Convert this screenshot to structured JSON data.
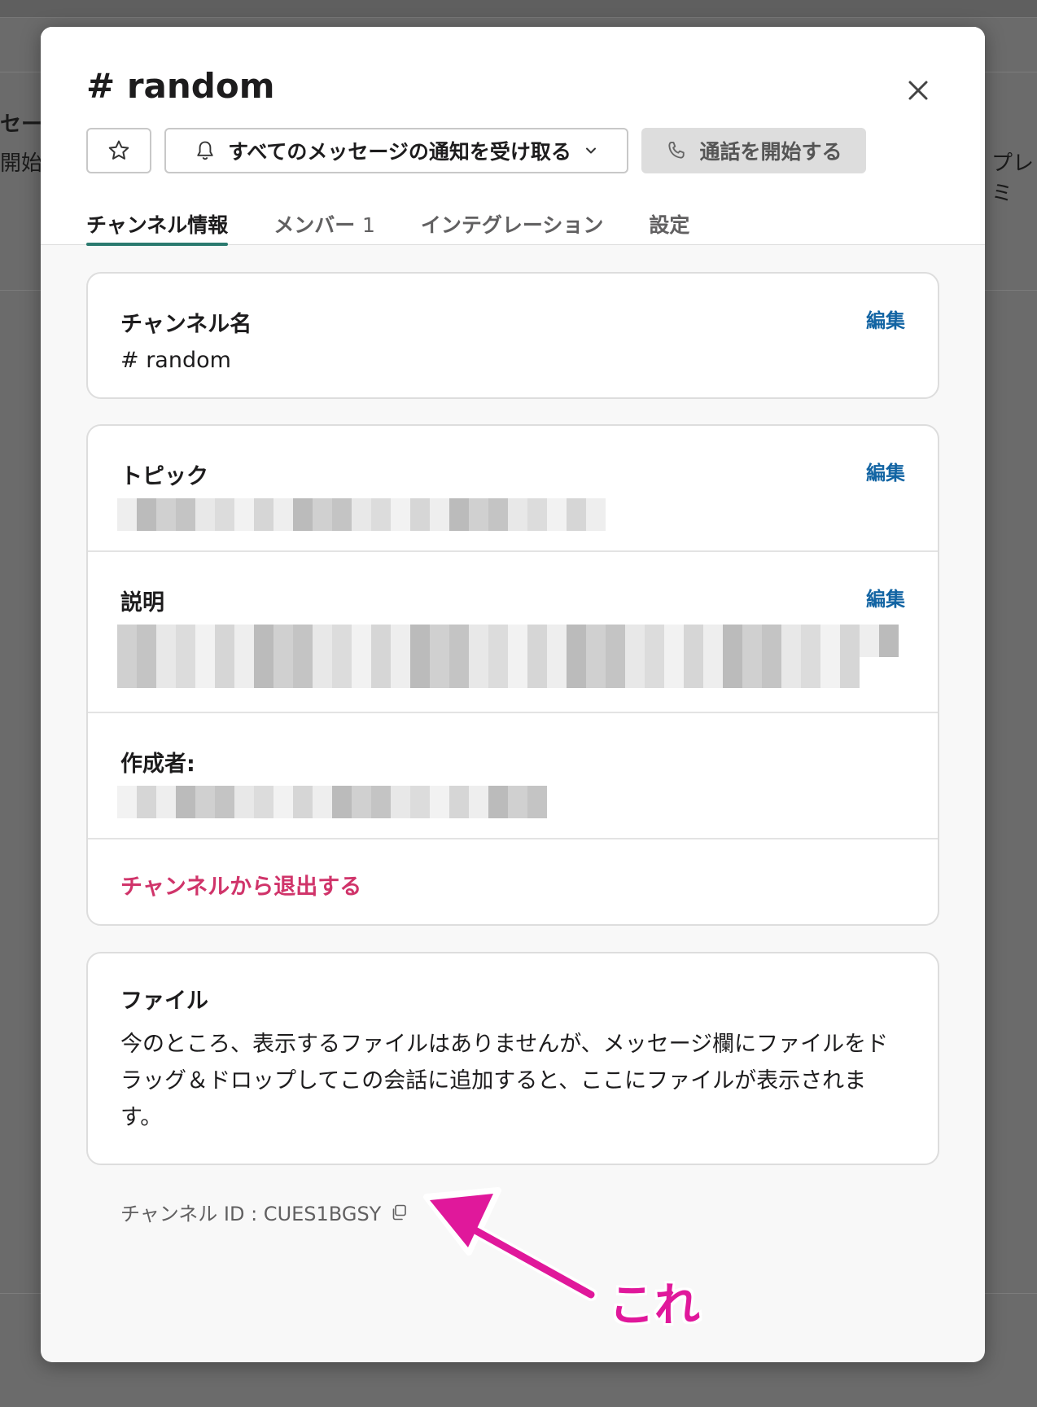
{
  "background": {
    "left_text_1": "セー",
    "left_text_2": "開始",
    "right_text": "プレミ"
  },
  "modal": {
    "title": "# random",
    "buttons": {
      "notify_label": "すべてのメッセージの通知を受け取る",
      "call_label": "通話を開始する"
    },
    "tabs": [
      {
        "label": "チャンネル情報",
        "count": ""
      },
      {
        "label": "メンバー",
        "count": "1"
      },
      {
        "label": "インテグレーション",
        "count": ""
      },
      {
        "label": "設定",
        "count": ""
      }
    ],
    "channel_name": {
      "label": "チャンネル名",
      "value": "# random",
      "edit": "編集"
    },
    "topic": {
      "label": "トピック",
      "edit": "編集"
    },
    "description": {
      "label": "説明",
      "edit": "編集"
    },
    "creator": {
      "label": "作成者:"
    },
    "leave": "チャンネルから退出する",
    "files": {
      "label": "ファイル",
      "text": "今のところ、表示するファイルはありませんが、メッセージ欄にファイルをドラッグ＆ドロップしてこの会話に追加すると、ここにファイルが表示されます。"
    },
    "channel_id": "チャンネル ID : CUES1BGSY"
  },
  "annotation": {
    "label": "これ",
    "color": "#e0189b"
  },
  "colors": {
    "accent_tab": "#2b7a6f",
    "link": "#1264a3",
    "danger": "#d0346a"
  },
  "icons": [
    "star-icon",
    "bell-icon",
    "chevron-down-icon",
    "phone-icon",
    "close-icon",
    "copy-icon",
    "arrow-icon"
  ]
}
